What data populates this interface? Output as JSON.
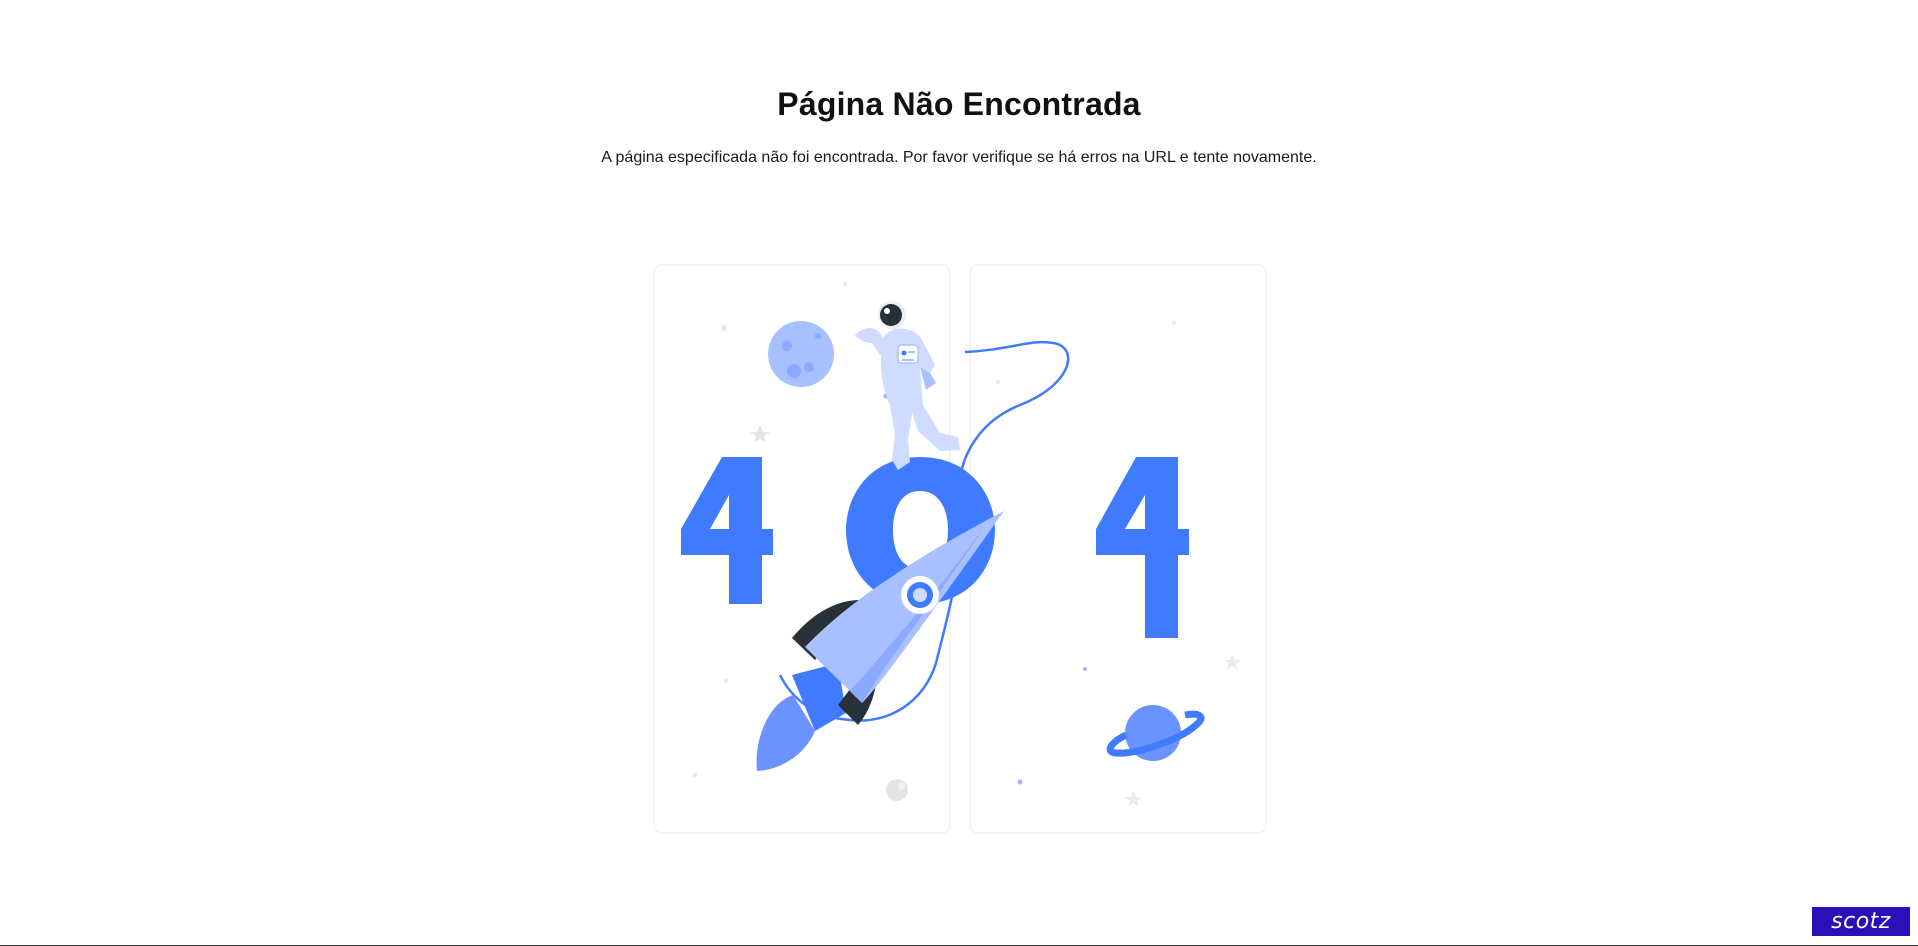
{
  "page": {
    "title": "Página Não Encontrada",
    "message": "A página especificada não foi encontrada. Por favor verifique se há erros na URL e tente novamente."
  },
  "illustration": {
    "error_code": "404",
    "icons": [
      "rocket-icon",
      "astronaut-icon",
      "moon-icon",
      "planet-icon",
      "star-icon"
    ],
    "colors": {
      "primary_blue": "#407bff",
      "dark_blue": "#2f5fcf",
      "light_blue": "#a8c0ff",
      "pale_blue": "#cfdcff",
      "dark": "#263238",
      "frame": "#eef0f5"
    }
  },
  "brand": {
    "label": "scotz",
    "color": "#2b10b8"
  }
}
